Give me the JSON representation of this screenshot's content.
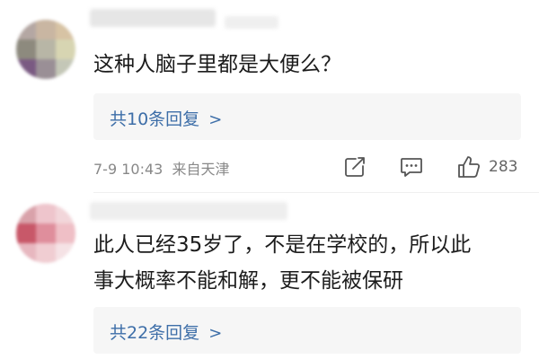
{
  "comments": [
    {
      "text_lines": [
        "这种人脑子里都是大便么？"
      ],
      "replies_label": "共10条回复",
      "time": "7-9 10:43",
      "location": "来自天津",
      "likes": "283",
      "avatar_colors": [
        "#b4a7a3",
        "#c9b6a2",
        "#d7c3a4",
        "#8d8a7e",
        "#b8b6a6",
        "#d7d5b2",
        "#7a5a82",
        "#9a8f96",
        "#c4c7b7"
      ]
    },
    {
      "text_lines": [
        "此人已经35岁了，不是在学校的，所以此",
        "事大概率不能和解，更不能被保研"
      ],
      "replies_label": "共22条回复",
      "avatar_colors": [
        "#d9a2aa",
        "#eec5cc",
        "#f2d6da",
        "#c85869",
        "#df8e9c",
        "#efbfc6",
        "#e7b7bf",
        "#f0cdd2",
        "#f5e2e5"
      ]
    }
  ],
  "icons": {
    "reply_arrow": "chevron-right-icon",
    "share": "share-icon",
    "comment": "comment-icon",
    "like": "thumbs-up-icon"
  },
  "colors": {
    "link": "#3d6ea8",
    "meta": "#888888",
    "reply_bg": "#f6f6f6"
  }
}
